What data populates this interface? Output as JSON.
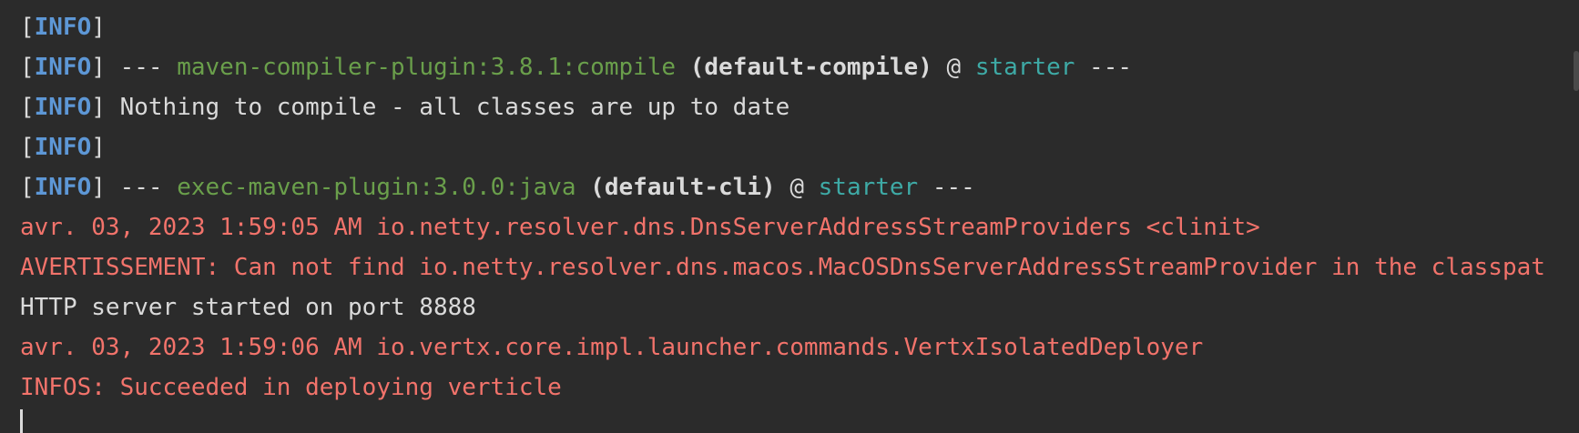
{
  "colors": {
    "background": "#2b2b2b",
    "text": "#dadada",
    "info_level": "#5d97d6",
    "plugin": "#6a9f4b",
    "project": "#3eaaa6",
    "stderr": "#f2736b"
  },
  "console": {
    "cut_line": "·········",
    "lines": [
      {
        "open": "[",
        "level": "INFO",
        "close": "]"
      },
      {
        "open": "[",
        "level": "INFO",
        "close": "]",
        "sep": " --- ",
        "plugin": "maven-compiler-plugin:3.8.1:compile",
        "execution": " (default-compile)",
        "at": " @ ",
        "project": "starter",
        "tail": " ---"
      },
      {
        "open": "[",
        "level": "INFO",
        "close": "]",
        "message": " Nothing to compile - all classes are up to date"
      },
      {
        "open": "[",
        "level": "INFO",
        "close": "]"
      },
      {
        "open": "[",
        "level": "INFO",
        "close": "]",
        "sep": " --- ",
        "plugin": "exec-maven-plugin:3.0.0:java",
        "execution": " (default-cli)",
        "at": " @ ",
        "project": "starter",
        "tail": " ---"
      },
      {
        "text": "avr. 03, 2023 1:59:05 AM io.netty.resolver.dns.DnsServerAddressStreamProviders <clinit>"
      },
      {
        "text": "AVERTISSEMENT: Can not find io.netty.resolver.dns.macos.MacOSDnsServerAddressStreamProvider in the classpat"
      },
      {
        "text": "HTTP server started on port 8888"
      },
      {
        "text": "avr. 03, 2023 1:59:06 AM io.vertx.core.impl.launcher.commands.VertxIsolatedDeployer"
      },
      {
        "text": "INFOS: Succeeded in deploying verticle"
      }
    ]
  }
}
